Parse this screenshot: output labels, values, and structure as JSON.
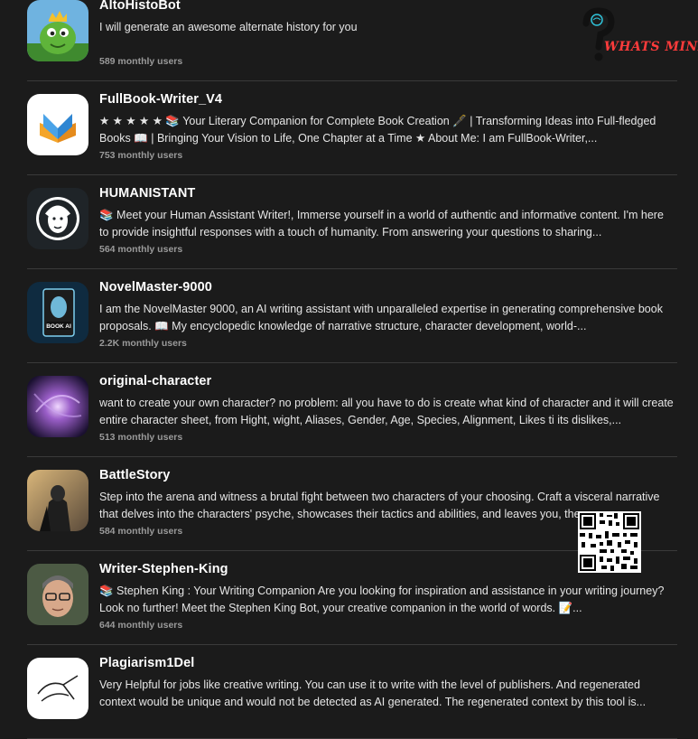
{
  "items": [
    {
      "name": "AltoHistoBot",
      "description": "I will generate an awesome alternate history for you",
      "users": "589 monthly users",
      "icon": "green-creature-avatar-icon"
    },
    {
      "name": "FullBook-Writer_V4",
      "description": "★ ★ ★ ★ ★ 📚 Your Literary Companion for Complete Book Creation 🖋️ | Transforming Ideas into Full-fledged Books 📖 | Bringing Your Vision to Life, One Chapter at a Time ★ About Me: I am FullBook-Writer,...",
      "users": "753 monthly users",
      "icon": "open-book-icon"
    },
    {
      "name": "HUMANISTANT",
      "description": "📚 Meet your Human Assistant Writer!, Immerse yourself in a world of authentic and informative content. I'm here to provide insightful responses with a touch of humanity. From answering your questions to sharing...",
      "users": "564 monthly users",
      "icon": "face-portrait-icon"
    },
    {
      "name": "NovelMaster-9000",
      "description": "I am the NovelMaster 9000, an AI writing assistant with unparalleled expertise in generating comprehensive book proposals. 📖 My encyclopedic knowledge of narrative structure, character development, world-...",
      "users": "2.2K monthly users",
      "icon": "book-ai-icon",
      "badge": "BOOK AI"
    },
    {
      "name": "original-character",
      "description": "want to create your own character? no problem: all you have to do is create what kind of character and it will create entire character sheet, from Hight, wight, Aliases, Gender, Age, Species, Alignment, Likes ti its dislikes,...",
      "users": "513 monthly users",
      "icon": "cosmic-swirl-icon"
    },
    {
      "name": "BattleStory",
      "description": "Step into the arena and witness a brutal fight between two characters of your choosing. Craft a visceral narrative that delves into the characters' psyche, showcases their tactics and abilities, and leaves you, the...",
      "users": "584 monthly users",
      "icon": "armored-warrior-icon"
    },
    {
      "name": "Writer-Stephen-King",
      "description": "📚 Stephen King : Your Writing Companion Are you looking for inspiration and assistance in your writing journey? Look no further! Meet the Stephen King Bot, your creative companion in the world of words. 📝...",
      "users": "644 monthly users",
      "icon": "man-portrait-icon"
    },
    {
      "name": "Plagiarism1Del",
      "description": "Very Helpful for jobs like creative writing. You can use it to write with the level of publishers. And regenerated context would be unique and would not be detected as AI generated. The regenerated context by this tool is...",
      "users": "",
      "icon": "hand-sketch-icon"
    }
  ],
  "watermark": {
    "text": "WHATS MIND",
    "color": "#ff3b3b",
    "icon": "question-mark-brain-icon"
  },
  "qr": {
    "icon": "qr-code-icon"
  }
}
